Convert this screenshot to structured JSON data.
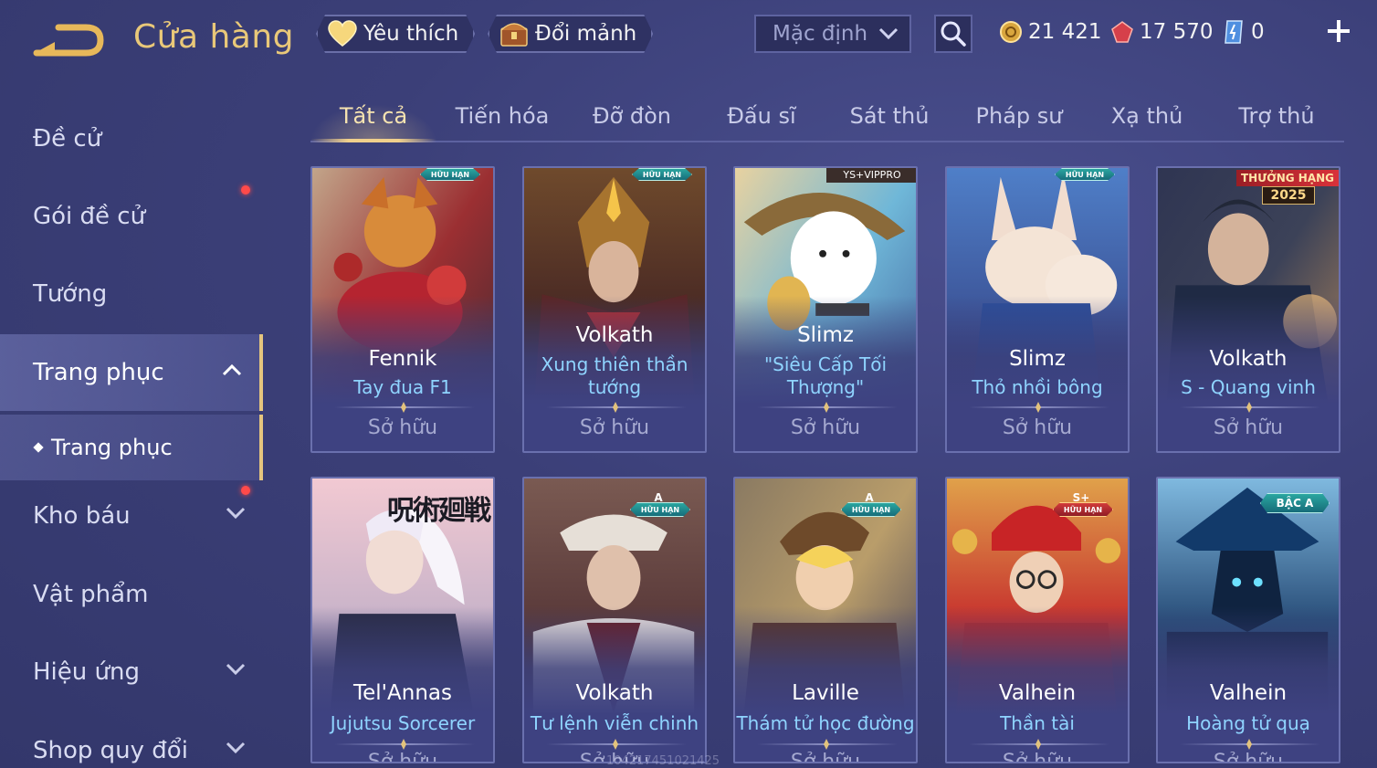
{
  "header": {
    "title": "Cửa hàng",
    "favorites_label": "Yêu thích",
    "exchange_label": "Đổi mảnh",
    "sort_value": "Mặc định",
    "currencies": [
      {
        "icon": "gold-coin-icon",
        "value": "21 421"
      },
      {
        "icon": "red-gem-icon",
        "value": "17 570"
      },
      {
        "icon": "blue-voucher-icon",
        "value": "0"
      }
    ]
  },
  "sidebar": {
    "items": [
      {
        "label": "Đề cử"
      },
      {
        "label": "Gói đề cử"
      },
      {
        "label": "Tướng"
      },
      {
        "label": "Trang phục"
      },
      {
        "label": "Kho báu"
      },
      {
        "label": "Vật phẩm"
      },
      {
        "label": "Hiệu ứng"
      },
      {
        "label": "Shop quy đổi"
      }
    ],
    "sub_item": "Trang phục"
  },
  "tabs": [
    "Tất cả",
    "Tiến hóa",
    "Đỡ đòn",
    "Đấu sĩ",
    "Sát thủ",
    "Pháp sư",
    "Xạ thủ",
    "Trợ thủ"
  ],
  "cards": [
    {
      "hero": "Fennik",
      "skin": "Tay đua F1",
      "status": "Sở hữu",
      "badge": "HỮU HẠN"
    },
    {
      "hero": "Volkath",
      "skin_line1": "Xung thiên thần",
      "skin_line2": "tướng",
      "status": "Sở hữu",
      "badge": "HỮU HẠN"
    },
    {
      "hero": "Slimz",
      "skin_line1": "\"Siêu Cấp Tối",
      "skin_line2": "Thượng\"",
      "status": "Sở hữu",
      "overlay": "YS+VIPPRO"
    },
    {
      "hero": "Slimz",
      "skin": "Thỏ nhồi bông",
      "status": "Sở hữu",
      "badge": "HỮU HẠN"
    },
    {
      "hero": "Volkath",
      "skin": "S - Quang vinh",
      "status": "Sở hữu",
      "rank_banner": "THƯỞNG HẠNG",
      "rank_year": "2025"
    },
    {
      "hero": "Tel'Annas",
      "skin": "Jujutsu Sorcerer",
      "status": "Sở hữu",
      "art_title": "呪術廻戦"
    },
    {
      "hero": "Volkath",
      "skin": "Tư lệnh viễn chinh",
      "status": "Sở hữu",
      "badge_grade": "A",
      "badge": "HỮU HẠN"
    },
    {
      "hero": "Laville",
      "skin": "Thám tử học đường",
      "status": "Sở hữu",
      "badge_grade": "A",
      "badge": "HỮU HẠN"
    },
    {
      "hero": "Valhein",
      "skin": "Thần tài",
      "status": "Sở hữu",
      "badge_grade": "S+",
      "badge": "HỮU HẠN"
    },
    {
      "hero": "Valhein",
      "skin": "Hoàng tử quạ",
      "status": "Sở hữu",
      "badge": "BẬC A"
    }
  ],
  "watermark": "104217451021425",
  "colors": {
    "accent_gold": "#e9c879",
    "skin_name_blue": "#8fd4ff",
    "background": "#3b3f78"
  }
}
